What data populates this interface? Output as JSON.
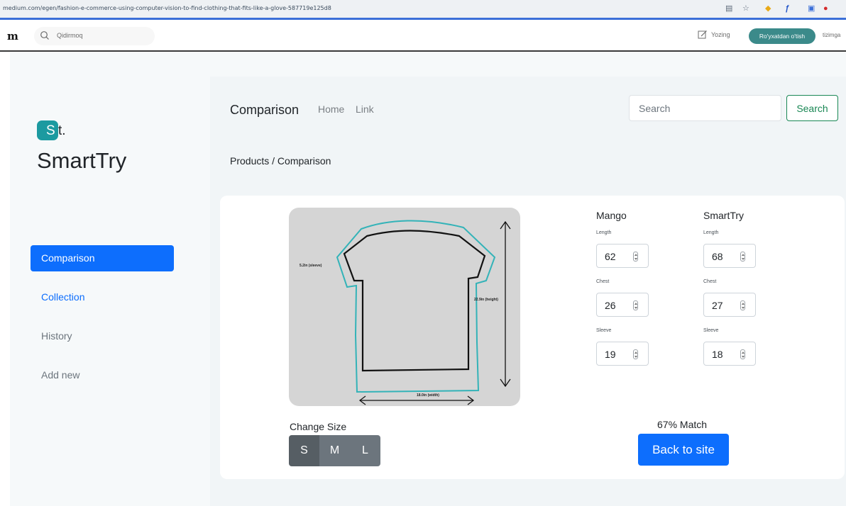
{
  "browser": {
    "url": "medium.com/egen/fashion-e-commerce-using-computer-vision-to-find-clothing-that-fits-like-a-glove-587719e125d8"
  },
  "medium": {
    "logo": "m",
    "search_placeholder": "Qidirmoq",
    "write_label": "Yozing",
    "register_label": "Ro'yxatdan o'tish",
    "login_label": "tizimga"
  },
  "brand": {
    "mark_letter": "S",
    "mark_suffix": "t.",
    "name": "SmartTry",
    "accent": "#1c9aa0"
  },
  "sidebar": {
    "items": [
      {
        "label": "Comparison",
        "state": "active"
      },
      {
        "label": "Collection",
        "state": "link"
      },
      {
        "label": "History",
        "state": "muted"
      },
      {
        "label": "Add new",
        "state": "muted"
      }
    ]
  },
  "topnav": {
    "title": "Comparison",
    "links": [
      "Home",
      "Link"
    ],
    "search_placeholder": "Search",
    "search_button": "Search"
  },
  "breadcrumb": "Products / Comparison",
  "shirt": {
    "sleeve_label": "5.2in (sleeve)",
    "height_label": "22.9in (height)",
    "width_label": "18.0in (width)"
  },
  "change_size": {
    "label": "Change Size",
    "options": [
      "S",
      "M",
      "L"
    ],
    "selected": "S"
  },
  "comparison": {
    "columns": [
      {
        "name": "Mango",
        "fields": [
          {
            "label": "Length",
            "value": "62"
          },
          {
            "label": "Chest",
            "value": "26"
          },
          {
            "label": "Sleeve",
            "value": "19"
          }
        ]
      },
      {
        "name": "SmartTry",
        "fields": [
          {
            "label": "Length",
            "value": "68"
          },
          {
            "label": "Chest",
            "value": "27"
          },
          {
            "label": "Sleeve",
            "value": "18"
          }
        ]
      }
    ],
    "match_text": "67% Match",
    "back_button": "Back to site"
  },
  "colors": {
    "primary": "#0d6efd",
    "success": "#198754",
    "register_bg": "#3b8a8a"
  }
}
